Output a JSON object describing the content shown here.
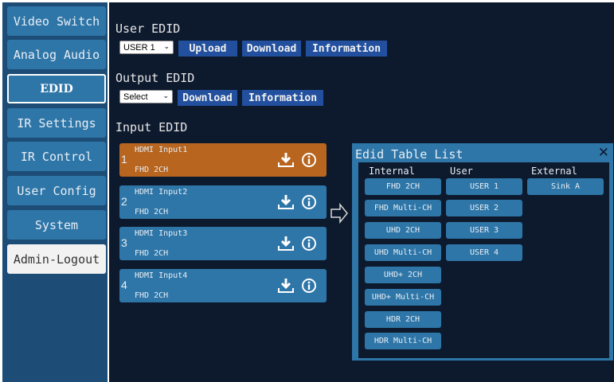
{
  "sidebar": {
    "items": [
      {
        "label": "Video Switch"
      },
      {
        "label": "Analog Audio"
      },
      {
        "label": "EDID"
      },
      {
        "label": "IR Settings"
      },
      {
        "label": "IR Control"
      },
      {
        "label": "User Config"
      },
      {
        "label": "System"
      },
      {
        "label": "Admin-Logout"
      }
    ],
    "active": "EDID"
  },
  "user_edid": {
    "title": "User EDID",
    "select_value": "USER 1",
    "upload_label": "Upload",
    "download_label": "Download",
    "information_label": "Information"
  },
  "output_edid": {
    "title": "Output EDID",
    "select_value": "Select",
    "download_label": "Download",
    "information_label": "Information"
  },
  "input_edid": {
    "title": "Input EDID",
    "inputs": [
      {
        "number": "1",
        "name": "HDMI Input1",
        "edid": "FHD 2CH",
        "selected": true
      },
      {
        "number": "2",
        "name": "HDMI Input2",
        "edid": "FHD 2CH",
        "selected": false
      },
      {
        "number": "3",
        "name": "HDMI Input3",
        "edid": "FHD 2CH",
        "selected": false
      },
      {
        "number": "4",
        "name": "HDMI Input4",
        "edid": "FHD 2CH",
        "selected": false
      }
    ]
  },
  "edid_table": {
    "title": "Edid Table List",
    "close_glyph": "✕",
    "columns": {
      "internal": {
        "header": "Internal",
        "items": [
          "FHD 2CH",
          "FHD Multi-CH",
          "UHD 2CH",
          "UHD Multi-CH",
          "UHD+ 2CH",
          "UHD+ Multi-CH",
          "HDR 2CH",
          "HDR Multi-CH"
        ]
      },
      "user": {
        "header": "User",
        "items": [
          "USER 1",
          "USER 2",
          "USER 3",
          "USER 4"
        ]
      },
      "external": {
        "header": "External",
        "items": [
          "Sink A"
        ]
      }
    }
  },
  "colors": {
    "sidebar_bg": "#1d4d77",
    "main_bg": "#0d1a2e",
    "button_blue": "#2e76a8",
    "action_button": "#22509e",
    "selected_input": "#b7651f"
  },
  "icons": {
    "select_chevron": "chevron-down-icon",
    "download": "download-icon",
    "info": "info-icon",
    "arrow": "arrow-right-icon",
    "close": "close-icon"
  }
}
